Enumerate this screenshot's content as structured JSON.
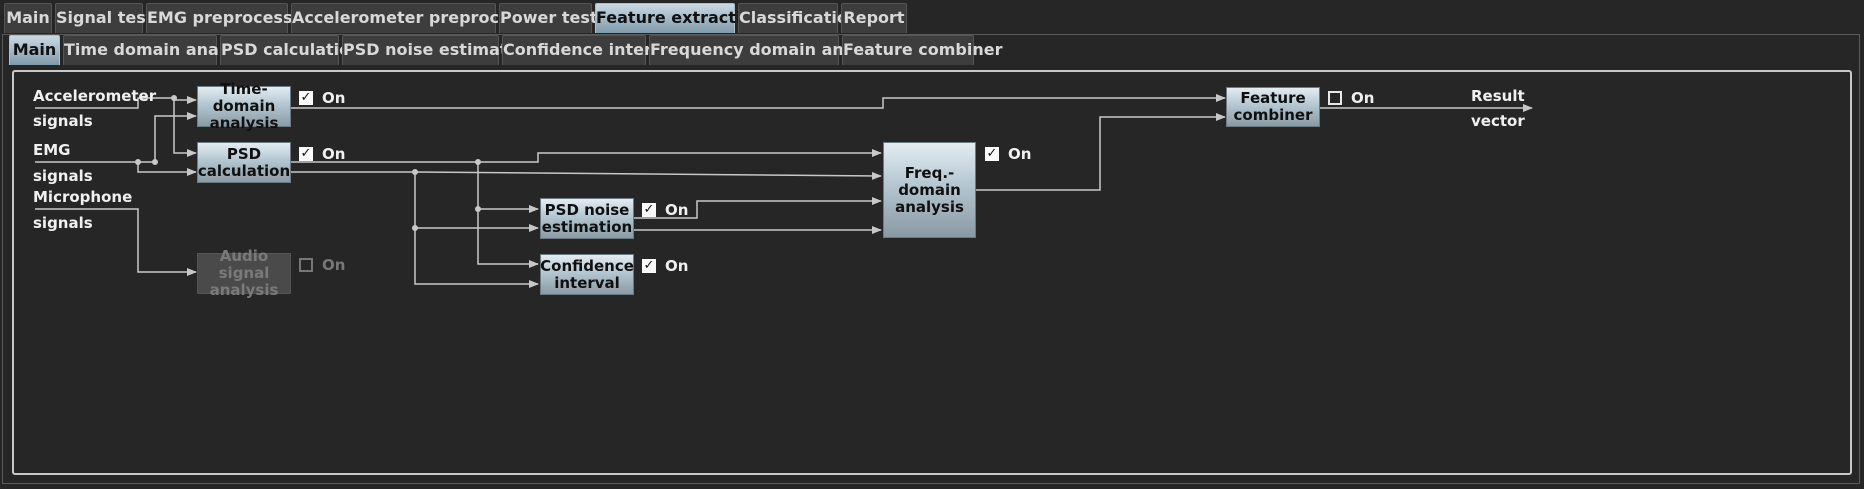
{
  "main_tabs": [
    {
      "label": "Main",
      "active": false
    },
    {
      "label": "Signal test",
      "active": false
    },
    {
      "label": "EMG preprocessing",
      "active": false
    },
    {
      "label": "Accelerometer preprocessing",
      "active": false
    },
    {
      "label": "Power test",
      "active": false
    },
    {
      "label": "Feature extraction",
      "active": true
    },
    {
      "label": "Classification",
      "active": false
    },
    {
      "label": "Report",
      "active": false
    }
  ],
  "sub_tabs": [
    {
      "label": "Main",
      "active": true
    },
    {
      "label": "Time domain analysis",
      "active": false
    },
    {
      "label": "PSD calculation",
      "active": false
    },
    {
      "label": "PSD noise estimation",
      "active": false
    },
    {
      "label": "Confidence interval",
      "active": false
    },
    {
      "label": "Frequency domain analysis",
      "active": false
    },
    {
      "label": "Feature combiner",
      "active": false
    }
  ],
  "inputs": {
    "accelerometer": {
      "line1": "Accelerometer",
      "line2": "signals"
    },
    "emg": {
      "line1": "EMG",
      "line2": "signals"
    },
    "microphone": {
      "line1": "Microphone",
      "line2": "signals"
    }
  },
  "output": {
    "line1": "Result",
    "line2": "vector"
  },
  "blocks": {
    "time_domain": {
      "label": "Time-domain\nanalysis",
      "on": true,
      "enabled": true
    },
    "psd_calc": {
      "label": "PSD\ncalculation",
      "on": true,
      "enabled": true
    },
    "audio": {
      "label": "Audio signal\nanalysis",
      "on": false,
      "enabled": false
    },
    "psd_noise": {
      "label": "PSD noise\nestimation",
      "on": true,
      "enabled": true
    },
    "confidence": {
      "label": "Confidence\ninterval",
      "on": true,
      "enabled": true
    },
    "freq_domain": {
      "label": "Freq.-domain\nanalysis",
      "on": true,
      "enabled": true
    },
    "combiner": {
      "label": "Feature\ncombiner",
      "on": false,
      "enabled": true
    }
  },
  "checkbox_label": "On",
  "colors": {
    "active_tab": "#b4c6d1",
    "block": "#b4c6d1",
    "background": "#262626",
    "wire": "#c8c8c8"
  }
}
